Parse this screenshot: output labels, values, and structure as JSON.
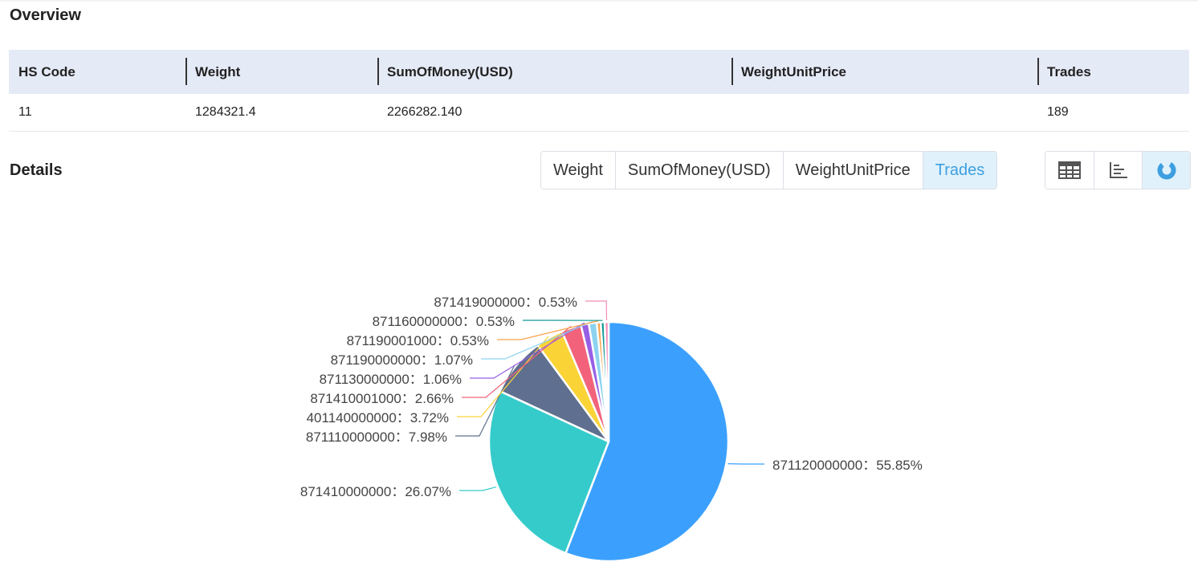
{
  "overview": {
    "title": "Overview",
    "columns": [
      "HS Code",
      "Weight",
      "SumOfMoney(USD)",
      "WeightUnitPrice",
      "Trades"
    ],
    "row": [
      "11",
      "1284321.4",
      "2266282.140",
      "",
      "189"
    ]
  },
  "details": {
    "title": "Details",
    "tabs": [
      "Weight",
      "SumOfMoney(USD)",
      "WeightUnitPrice",
      "Trades"
    ],
    "active_tab": "Trades",
    "view_buttons": [
      {
        "icon": "table-icon",
        "active": false
      },
      {
        "icon": "bar-chart-icon",
        "active": false
      },
      {
        "icon": "pie-chart-icon",
        "active": true
      }
    ]
  },
  "colors": {
    "accent": "#3d9fe0",
    "header_bg": "#e5eaf7",
    "active_bg": "#e0f1fb"
  },
  "chart_data": {
    "type": "pie",
    "title": "",
    "slices": [
      {
        "label": "871120000000",
        "value": 55.85,
        "text": "871120000000：55.85%",
        "color": "#3ba0fd"
      },
      {
        "label": "871410000000",
        "value": 26.07,
        "text": "871410000000：26.07%",
        "color": "#36cbcb"
      },
      {
        "label": "871110000000",
        "value": 7.98,
        "text": "871110000000：7.98%",
        "color": "#5f6f8f"
      },
      {
        "label": "401140000000",
        "value": 3.72,
        "text": "401140000000：3.72%",
        "color": "#fad337"
      },
      {
        "label": "871410001000",
        "value": 2.66,
        "text": "871410001000：2.66%",
        "color": "#f2637b"
      },
      {
        "label": "871130000000",
        "value": 1.06,
        "text": "871130000000：1.06%",
        "color": "#975fe4"
      },
      {
        "label": "871190000000",
        "value": 1.07,
        "text": "871190000000：1.07%",
        "color": "#8dd3f0"
      },
      {
        "label": "871190001000",
        "value": 0.53,
        "text": "871190001000：0.53%",
        "color": "#f8a34b"
      },
      {
        "label": "871160000000",
        "value": 0.53,
        "text": "871160000000：0.53%",
        "color": "#139994"
      },
      {
        "label": "871419000000",
        "value": 0.53,
        "text": "871419000000：0.53%",
        "color": "#f28cb8"
      }
    ]
  }
}
